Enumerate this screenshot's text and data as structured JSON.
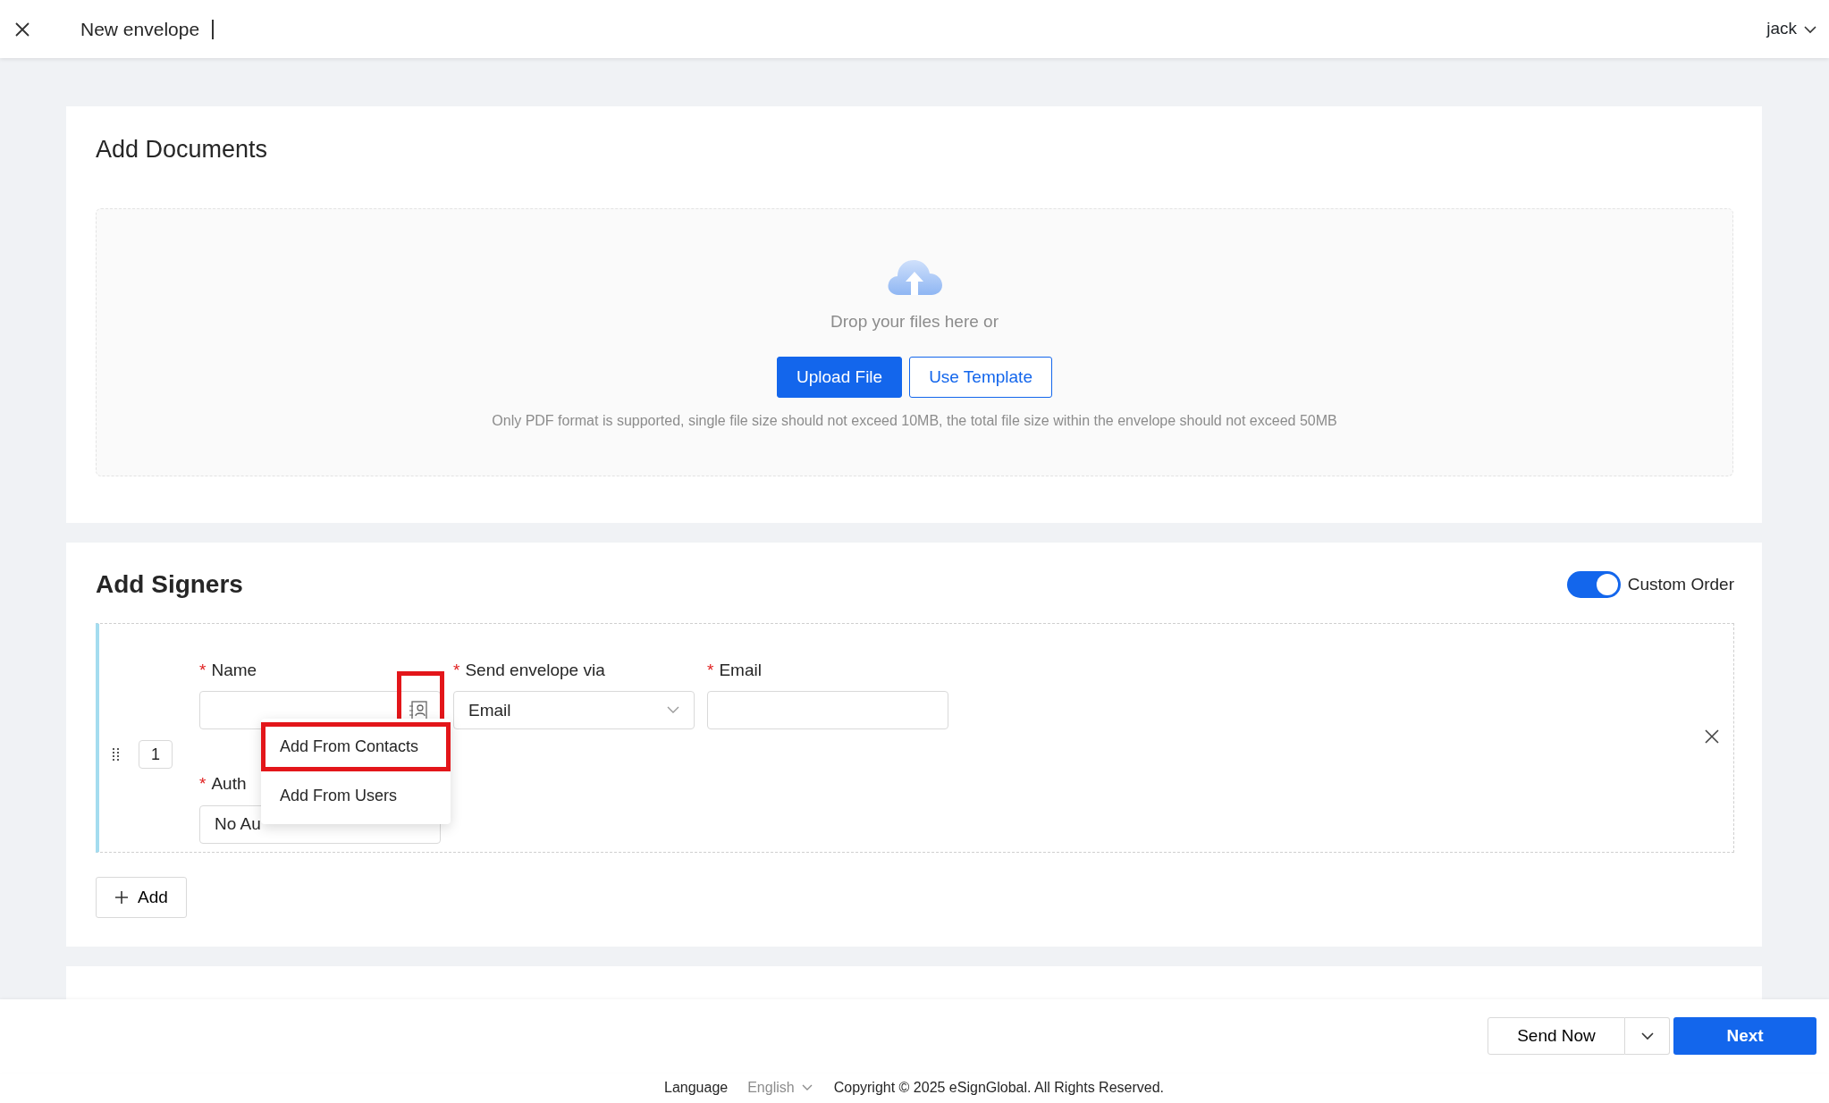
{
  "top_bar": {
    "title": "New envelope",
    "user": "jack"
  },
  "documents": {
    "title": "Add Documents",
    "drop_text": "Drop your files here or",
    "buttons": [
      {
        "label": "Upload File",
        "kind": "primary"
      },
      {
        "label": "Use Template",
        "kind": "outline"
      }
    ],
    "hint": "Only PDF format is supported, single file size should not exceed 10MB, the total file size within the envelope should not exceed 50MB"
  },
  "signers": {
    "title": "Add Signers",
    "custom_order": {
      "label": "Custom Order",
      "on": true
    },
    "rows": [
      {
        "number": "1",
        "name_label": {
          "mark": "*",
          "text": "Name"
        },
        "contact_icon_highlighted": true,
        "send_via_label": {
          "mark": "*",
          "text": "Send envelope via"
        },
        "send_via_value": "Email",
        "email_label": {
          "mark": "*",
          "text": "Email"
        },
        "auth_label": {
          "mark": "*",
          "text": "Auth"
        },
        "auth_value": "No Au",
        "menu": [
          {
            "label": "Add From Contacts",
            "highlighted": true
          },
          {
            "label": "Add From Users",
            "highlighted": false
          }
        ]
      }
    ],
    "add_button": "Add"
  },
  "actions": {
    "send_now": "Send Now",
    "next": "Next"
  },
  "footer": {
    "language_label": "Language",
    "language": "English",
    "copyright": "Copyright © 2025 eSignGlobal. All Rights Reserved."
  }
}
